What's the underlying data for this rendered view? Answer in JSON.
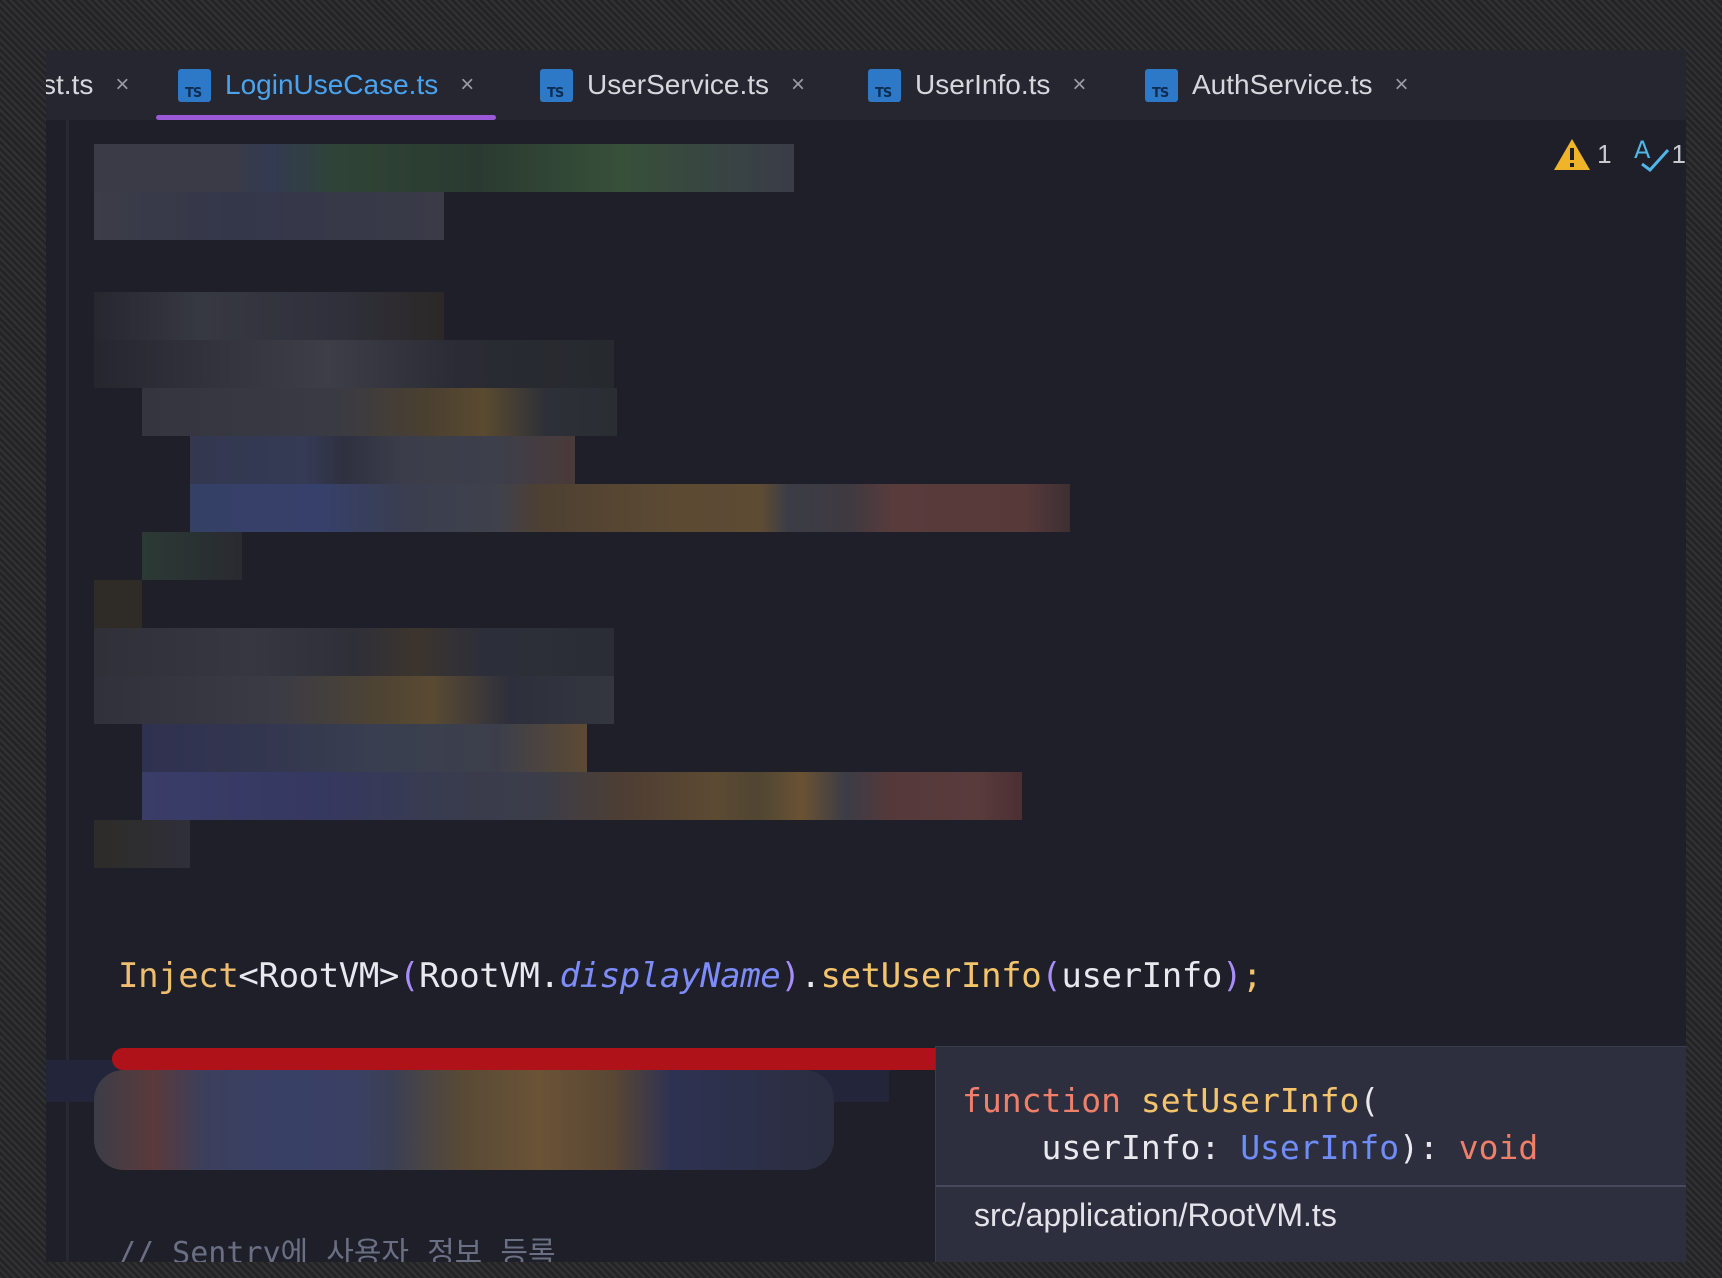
{
  "tabs": [
    {
      "name": "st.ts",
      "icon": "typescript-file-icon",
      "active": false
    },
    {
      "name": "LoginUseCase.ts",
      "icon": "typescript-file-icon",
      "active": true
    },
    {
      "name": "UserService.ts",
      "icon": "typescript-file-icon",
      "active": false
    },
    {
      "name": "UserInfo.ts",
      "icon": "typescript-file-icon",
      "active": false
    },
    {
      "name": "AuthService.ts",
      "icon": "typescript-file-icon",
      "active": false
    }
  ],
  "tab_close_glyph": "×",
  "ts_icon_text": "TS",
  "inspections": {
    "warning_count": "1",
    "typo_count": "1"
  },
  "code": {
    "highlight_line": {
      "inject": "Inject",
      "generic_open": "<",
      "root_vm": "RootVM",
      "generic_close": ">",
      "paren_open": "(",
      "root_vm_arg": "RootVM",
      "dot1": ".",
      "display_name": "displayName",
      "paren_close": ")",
      "dot2": ".",
      "method": "setUserInfo",
      "paren_open2": "(",
      "arg": "userInfo",
      "paren_close2": ")",
      "semicolon": ";"
    },
    "comment_line": "// Sentry에 사용자 정보 등록"
  },
  "popup": {
    "keyword": "function",
    "function_name": "setUserInfo",
    "paren_open": "(",
    "param_name": "userInfo",
    "colon": ":",
    "param_type": "UserInfo",
    "close": "):",
    "return_type": "void",
    "source_path": "src/application/RootVM.ts"
  },
  "colors": {
    "editor_bg": "#1e1f29",
    "active_tab_text": "#4aa3ef",
    "active_tab_underline": "#9b59d8",
    "error_underline": "#b0121a",
    "warning": "#f0b429",
    "keyword": "#f07f6a",
    "function": "#f4c46c",
    "type": "#6f8cf8"
  }
}
